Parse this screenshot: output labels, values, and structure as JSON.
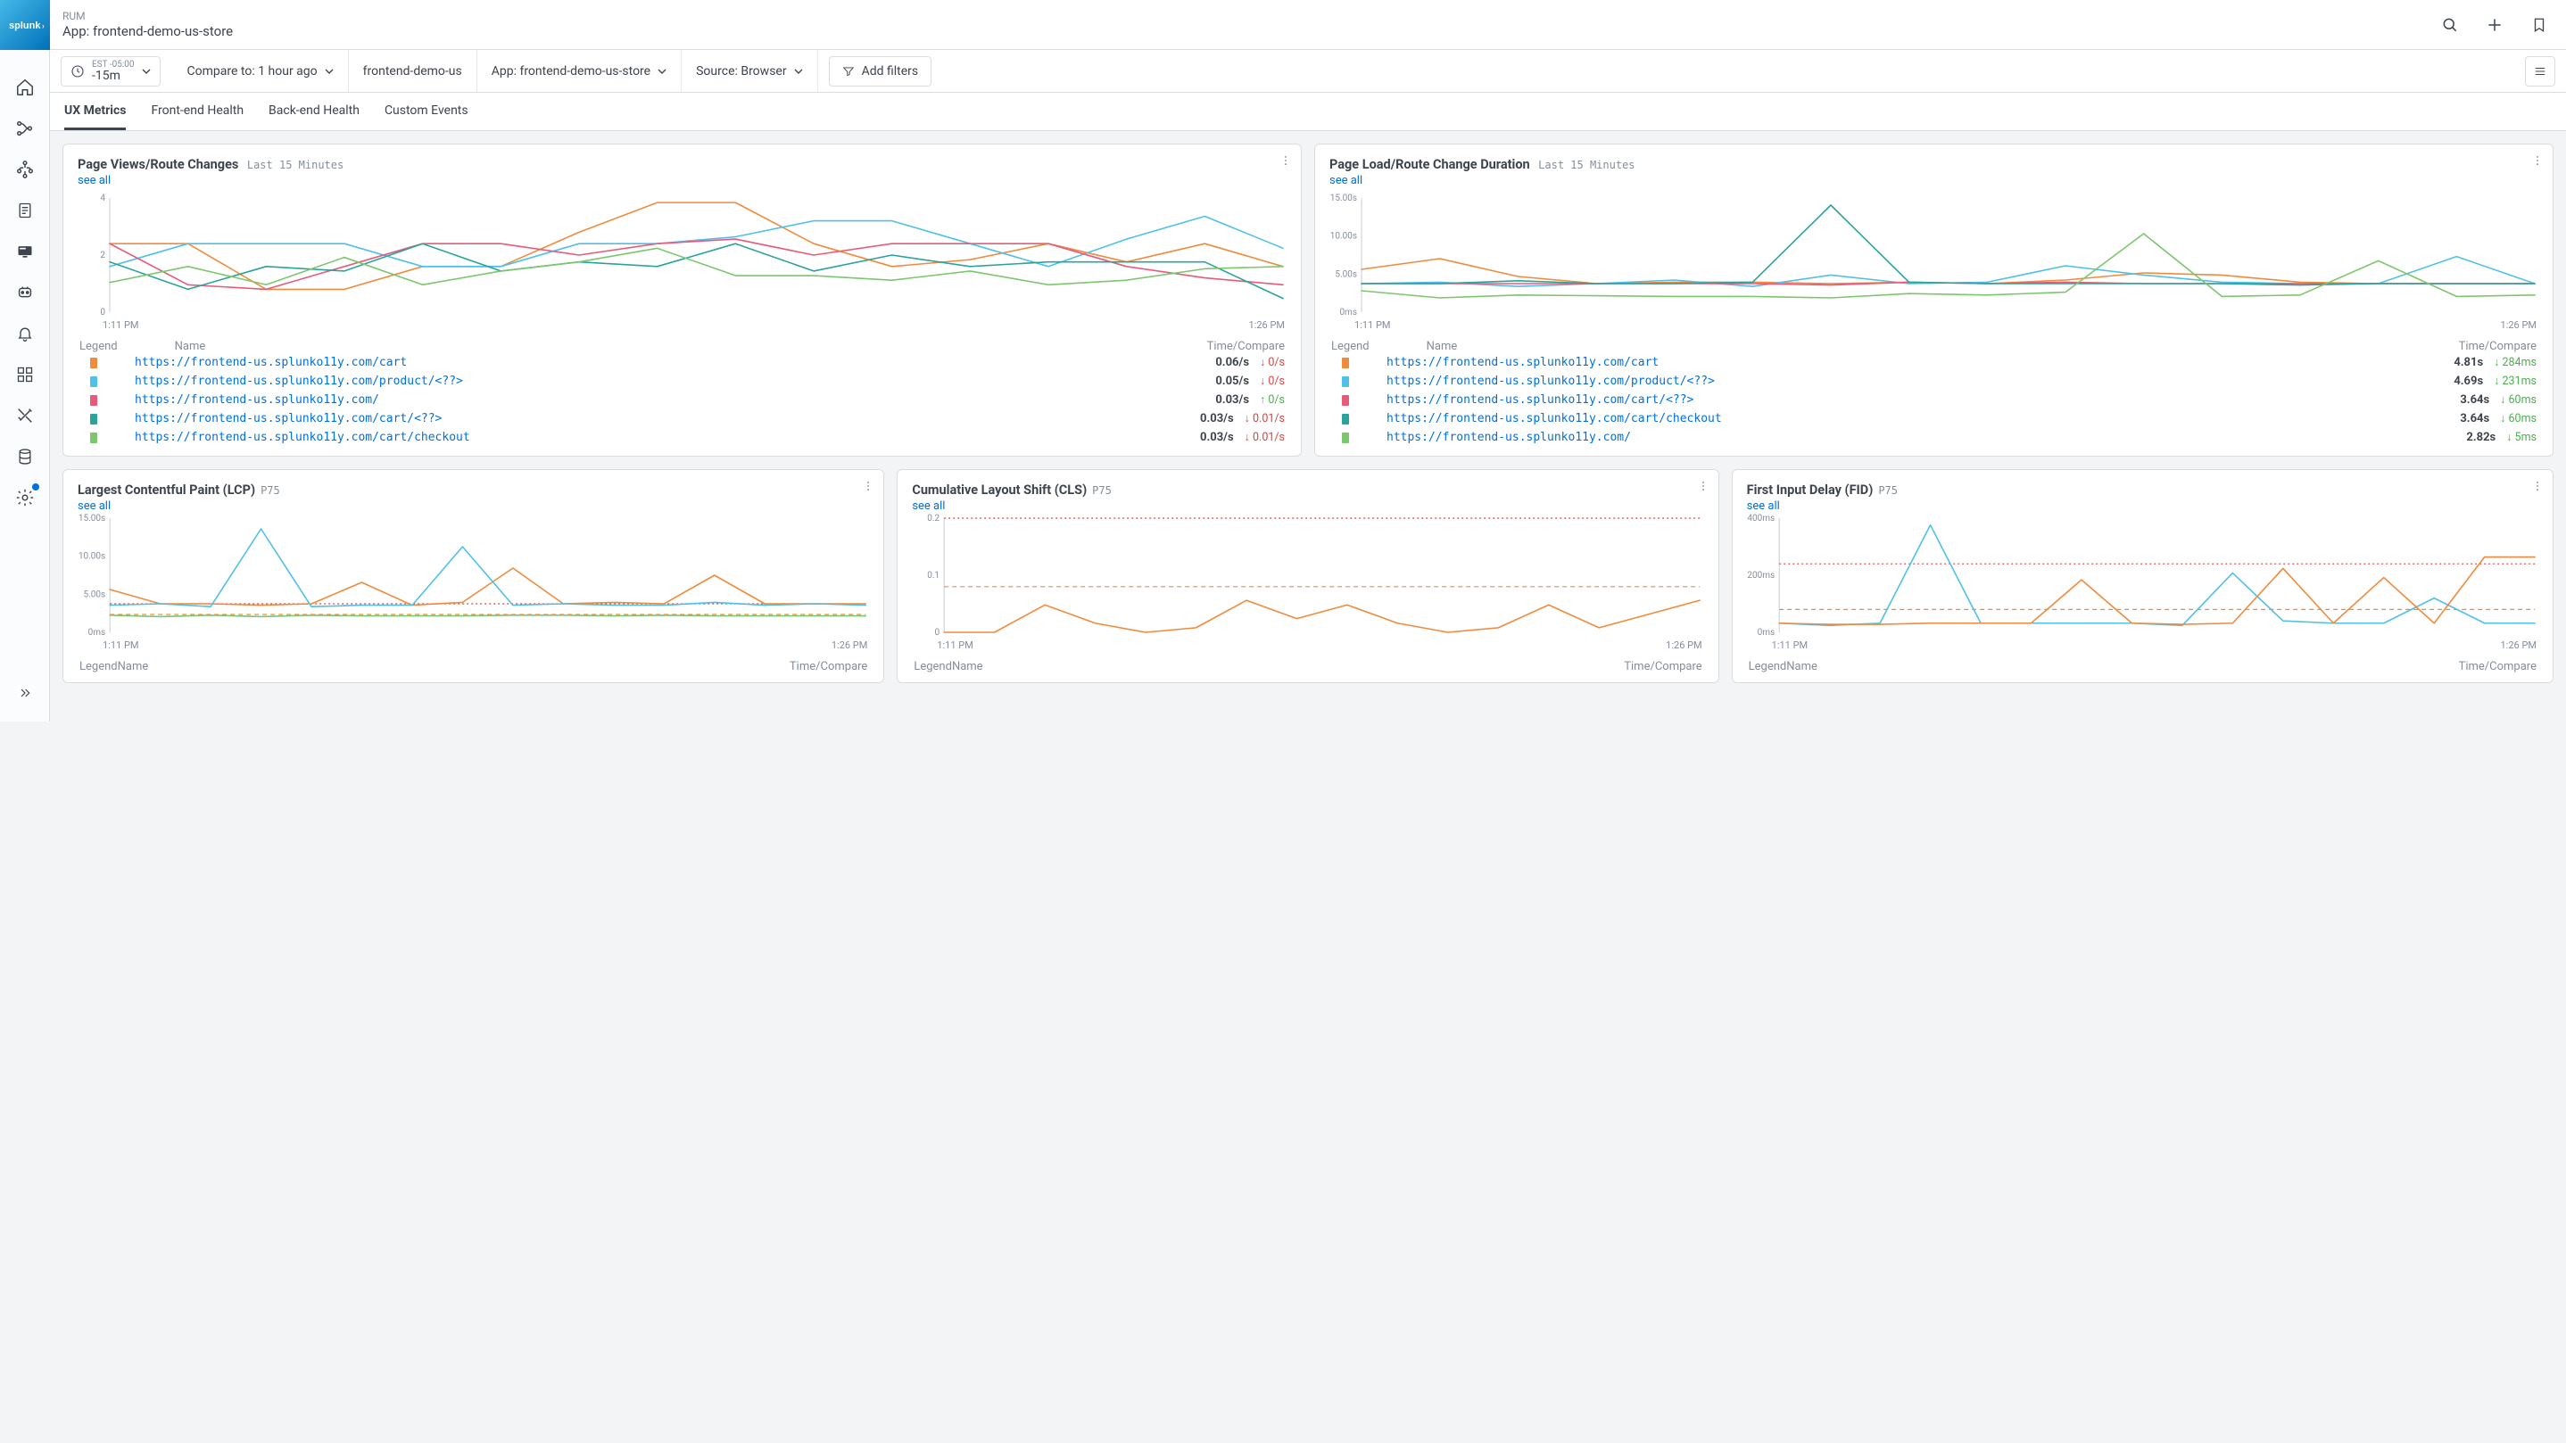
{
  "header": {
    "product": "RUM",
    "title": "App: frontend-demo-us-store"
  },
  "filters": {
    "time_tz": "EST -05:00",
    "time_range": "-15m",
    "compare": "Compare to: 1 hour ago",
    "fe": "frontend-demo-us",
    "app": "App: frontend-demo-us-store",
    "source": "Source: Browser",
    "add_filters": "Add filters"
  },
  "tabs": [
    "UX Metrics",
    "Front-end Health",
    "Back-end Health",
    "Custom Events"
  ],
  "active_tab": 0,
  "legend_headers": {
    "legend": "Legend",
    "name": "Name",
    "time": "Time/Compare"
  },
  "small_legend_labels": {
    "legend": "Legend",
    "name": "Name",
    "time": "Time/Compare"
  },
  "colors": {
    "orange": "#f08a3c",
    "cyan": "#4fc0e8",
    "pink": "#e85a7a",
    "teal": "#2aa39c",
    "green": "#7cc66d"
  },
  "cards": {
    "pv": {
      "title": "Page Views/Route Changes",
      "sub": "Last 15 Minutes",
      "see_all": "see all",
      "time_start": "1:11 PM",
      "time_end": "1:26 PM",
      "yticks": [
        "0",
        "2",
        "4"
      ],
      "rows": [
        {
          "c": "orange",
          "name": "https://frontend-us.splunko11y.com/cart",
          "val": "0.06/s",
          "dir": "down",
          "delta": "0/s"
        },
        {
          "c": "cyan",
          "name": "https://frontend-us.splunko11y.com/product/<??>",
          "val": "0.05/s",
          "dir": "down",
          "delta": "0/s"
        },
        {
          "c": "pink",
          "name": "https://frontend-us.splunko11y.com/",
          "val": "0.03/s",
          "dir": "up",
          "delta": "0/s"
        },
        {
          "c": "teal",
          "name": "https://frontend-us.splunko11y.com/cart/<??>",
          "val": "0.03/s",
          "dir": "down",
          "delta": "0.01/s"
        },
        {
          "c": "green",
          "name": "https://frontend-us.splunko11y.com/cart/checkout",
          "val": "0.03/s",
          "dir": "down",
          "delta": "0.01/s"
        }
      ]
    },
    "dur": {
      "title": "Page Load/Route Change Duration",
      "sub": "Last 15 Minutes",
      "see_all": "see all",
      "time_start": "1:11 PM",
      "time_end": "1:26 PM",
      "yticks": [
        "0ms",
        "5.00s",
        "10.00s",
        "15.00s"
      ],
      "rows": [
        {
          "c": "orange",
          "name": "https://frontend-us.splunko11y.com/cart",
          "val": "4.81s",
          "dir": "good",
          "delta": "284ms"
        },
        {
          "c": "cyan",
          "name": "https://frontend-us.splunko11y.com/product/<??>",
          "val": "4.69s",
          "dir": "good",
          "delta": "231ms"
        },
        {
          "c": "pink",
          "name": "https://frontend-us.splunko11y.com/cart/<??>",
          "val": "3.64s",
          "dir": "good",
          "delta": "60ms"
        },
        {
          "c": "teal",
          "name": "https://frontend-us.splunko11y.com/cart/checkout",
          "val": "3.64s",
          "dir": "good",
          "delta": "60ms"
        },
        {
          "c": "green",
          "name": "https://frontend-us.splunko11y.com/",
          "val": "2.82s",
          "dir": "good",
          "delta": "5ms"
        }
      ]
    },
    "lcp": {
      "title": "Largest Contentful Paint (LCP)",
      "sub": "P75",
      "see_all": "see all",
      "time_start": "1:11 PM",
      "time_end": "1:26 PM",
      "yticks": [
        "0ms",
        "5.00s",
        "10.00s",
        "15.00s"
      ]
    },
    "cls": {
      "title": "Cumulative Layout Shift (CLS)",
      "sub": "P75",
      "see_all": "see all",
      "time_start": "1:11 PM",
      "time_end": "1:26 PM",
      "yticks": [
        "0",
        "0.1",
        "0.2"
      ]
    },
    "fid": {
      "title": "First Input Delay (FID)",
      "sub": "P75",
      "see_all": "see all",
      "time_start": "1:11 PM",
      "time_end": "1:26 PM",
      "yticks": [
        "0ms",
        "200ms",
        "400ms"
      ]
    }
  },
  "chart_data": [
    {
      "id": "pv",
      "type": "line",
      "title": "Page Views/Route Changes",
      "xlabel": "",
      "ylabel": "",
      "ylim": [
        0,
        5
      ],
      "x_range": [
        "1:11 PM",
        "1:26 PM"
      ],
      "x": [
        0,
        1,
        2,
        3,
        4,
        5,
        6,
        7,
        8,
        9,
        10,
        11,
        12,
        13,
        14,
        15
      ],
      "series": [
        {
          "name": "cart",
          "color": "orange",
          "values": [
            3,
            3,
            1,
            1,
            2,
            2,
            3.5,
            4.8,
            4.8,
            3,
            2,
            2.3,
            3,
            2.2,
            3,
            2
          ]
        },
        {
          "name": "product",
          "color": "cyan",
          "values": [
            2,
            3,
            3,
            3,
            2,
            2,
            3,
            3,
            3.3,
            4,
            4,
            3,
            2,
            3.2,
            4.2,
            2.8
          ]
        },
        {
          "name": "root",
          "color": "pink",
          "values": [
            3,
            1.2,
            1,
            2,
            3,
            3,
            2.5,
            3,
            3.2,
            2.5,
            3,
            3,
            3,
            2,
            1.5,
            1.2
          ]
        },
        {
          "name": "cart-dyn",
          "color": "teal",
          "values": [
            2.2,
            1,
            2,
            1.8,
            3,
            1.8,
            2.2,
            2,
            3,
            1.8,
            2.5,
            2,
            2.2,
            2.2,
            2.2,
            0.6
          ]
        },
        {
          "name": "checkout",
          "color": "green",
          "values": [
            1.3,
            2,
            1.2,
            2.4,
            1.2,
            1.8,
            2.2,
            2.8,
            1.6,
            1.6,
            1.4,
            1.8,
            1.2,
            1.4,
            1.9,
            2
          ]
        }
      ]
    },
    {
      "id": "dur",
      "type": "line",
      "title": "Page Load/Route Change Duration",
      "ylim": [
        0,
        16
      ],
      "x_range": [
        "1:11 PM",
        "1:26 PM"
      ],
      "x": [
        0,
        1,
        2,
        3,
        4,
        5,
        6,
        7,
        8,
        9,
        10,
        11,
        12,
        13,
        14,
        15
      ],
      "series": [
        {
          "name": "cart",
          "color": "orange",
          "values": [
            6,
            7.5,
            5,
            4,
            4.2,
            4.2,
            4,
            4.2,
            4,
            4.5,
            5.5,
            5.2,
            4.2,
            4,
            4,
            4
          ]
        },
        {
          "name": "product",
          "color": "cyan",
          "values": [
            4,
            4.2,
            3.6,
            4,
            4.5,
            3.6,
            5.2,
            4,
            4.2,
            6.5,
            5.2,
            4.2,
            4,
            4,
            7.8,
            4
          ]
        },
        {
          "name": "cart-dyn",
          "color": "pink",
          "values": [
            4,
            4,
            4,
            4,
            4,
            4,
            3.8,
            4.2,
            4,
            4.2,
            4,
            4,
            4,
            4,
            4,
            4
          ]
        },
        {
          "name": "checkout",
          "color": "teal",
          "values": [
            4,
            4,
            4.4,
            4,
            4,
            4.2,
            15,
            4.2,
            4,
            4,
            4,
            4,
            3.8,
            4,
            4,
            4
          ]
        },
        {
          "name": "root",
          "color": "green",
          "values": [
            3,
            2,
            2.4,
            2.3,
            2.2,
            2.2,
            2,
            2.6,
            2.4,
            2.8,
            11,
            2.2,
            2.4,
            7.2,
            2.2,
            2.4
          ]
        }
      ]
    },
    {
      "id": "lcp",
      "type": "line",
      "title": "Largest Contentful Paint (LCP) P75",
      "ylim": [
        0,
        16
      ],
      "x_range": [
        "1:11 PM",
        "1:26 PM"
      ],
      "x": [
        0,
        1,
        2,
        3,
        4,
        5,
        6,
        7,
        8,
        9,
        10,
        11,
        12,
        13,
        14,
        15
      ],
      "thresholds": [
        {
          "value": 2.5,
          "style": "dashed",
          "color": "#f08a3c"
        },
        {
          "value": 4,
          "style": "dotted",
          "color": "#d64545"
        }
      ],
      "series": [
        {
          "name": "a",
          "color": "orange",
          "values": [
            6,
            4,
            4,
            3.8,
            4,
            7,
            3.8,
            4.2,
            9,
            4,
            4.2,
            4,
            8,
            4,
            4,
            4
          ]
        },
        {
          "name": "b",
          "color": "cyan",
          "values": [
            3.8,
            4,
            3.6,
            14.5,
            3.6,
            3.8,
            3.8,
            12,
            3.8,
            4,
            3.8,
            3.8,
            4.2,
            3.8,
            4,
            3.8
          ]
        },
        {
          "name": "c",
          "color": "green",
          "values": [
            2.4,
            2.2,
            2.4,
            2.2,
            2.4,
            2.3,
            2.3,
            2.3,
            2.4,
            2.4,
            2.3,
            2.4,
            2.3,
            2.3,
            2.3,
            2.3
          ]
        }
      ]
    },
    {
      "id": "cls",
      "type": "line",
      "title": "Cumulative Layout Shift (CLS) P75",
      "ylim": [
        0,
        0.25
      ],
      "x_range": [
        "1:11 PM",
        "1:26 PM"
      ],
      "x": [
        0,
        1,
        2,
        3,
        4,
        5,
        6,
        7,
        8,
        9,
        10,
        11,
        12,
        13,
        14,
        15
      ],
      "thresholds": [
        {
          "value": 0.1,
          "style": "dashed",
          "color": "#f08a3c"
        },
        {
          "value": 0.25,
          "style": "dotted",
          "color": "#d64545"
        }
      ],
      "series": [
        {
          "name": "a",
          "color": "orange",
          "values": [
            0,
            0,
            0.06,
            0.02,
            0,
            0.01,
            0.07,
            0.03,
            0.06,
            0.02,
            0,
            0.01,
            0.06,
            0.01,
            0.04,
            0.07
          ]
        }
      ]
    },
    {
      "id": "fid",
      "type": "line",
      "title": "First Input Delay (FID) P75",
      "ylim": [
        0,
        500
      ],
      "x_range": [
        "1:11 PM",
        "1:26 PM"
      ],
      "x": [
        0,
        1,
        2,
        3,
        4,
        5,
        6,
        7,
        8,
        9,
        10,
        11,
        12,
        13,
        14,
        15
      ],
      "thresholds": [
        {
          "value": 100,
          "style": "dashed",
          "color": "#f08a3c"
        },
        {
          "value": 300,
          "style": "dotted",
          "color": "#d64545"
        }
      ],
      "series": [
        {
          "name": "a",
          "color": "cyan",
          "values": [
            40,
            30,
            40,
            470,
            40,
            40,
            40,
            40,
            30,
            260,
            50,
            40,
            40,
            150,
            40,
            40
          ]
        },
        {
          "name": "b",
          "color": "orange",
          "values": [
            40,
            35,
            35,
            40,
            40,
            40,
            230,
            40,
            35,
            40,
            280,
            40,
            240,
            40,
            330,
            330
          ]
        }
      ]
    }
  ]
}
